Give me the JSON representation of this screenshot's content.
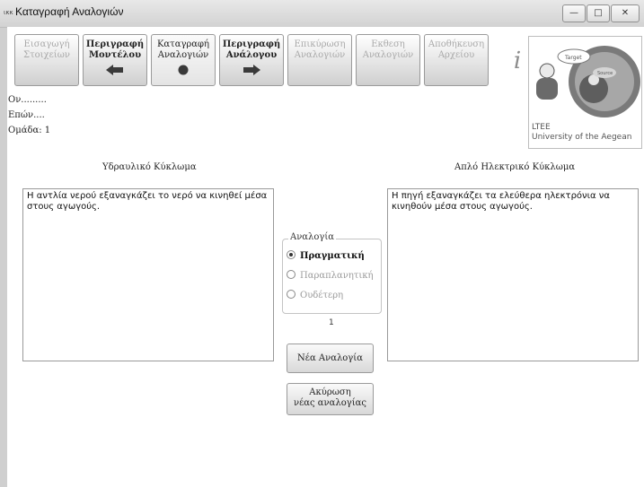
{
  "window": {
    "app_icon": "ικκ",
    "title": "Καταγραφή Αναλογιών",
    "controls": {
      "minimize": "—",
      "maximize": "□",
      "close": "✕"
    }
  },
  "tabs": [
    {
      "line1": "Εισαγωγή",
      "line2": "Στοιχείων",
      "state": "disabled",
      "icon": ""
    },
    {
      "line1": "Περιγραφή",
      "line2": "Μοντέλου",
      "state": "enabled",
      "icon": "arrow-left-icon"
    },
    {
      "line1": "Καταγραφή",
      "line2": "Αναλογιών",
      "state": "active",
      "icon": "dot-icon"
    },
    {
      "line1": "Περιγραφή",
      "line2": "Ανάλογου",
      "state": "enabled",
      "icon": "arrow-right-icon"
    },
    {
      "line1": "Επικύρωση",
      "line2": "Αναλογιών",
      "state": "disabled",
      "icon": ""
    },
    {
      "line1": "Εκθεση",
      "line2": "Αναλογιών",
      "state": "disabled",
      "icon": ""
    },
    {
      "line1": "Αποθήκευση",
      "line2": "Αρχείου",
      "state": "disabled",
      "icon": ""
    }
  ],
  "info_icon": "i",
  "logo": {
    "bubble1": "Target",
    "bubble2": "Source",
    "line1": "LTEE",
    "line2": "University of the Aegean"
  },
  "student": {
    "name": "Ον.........",
    "surname": "Επών....",
    "group": "Ομάδα: 1"
  },
  "left_panel": {
    "title": "Υδραυλικό Κύκλωμα",
    "text": "Η αντλία νερού εξαναγκάζει το νερό να κινηθεί μέσα στους αγωγούς."
  },
  "right_panel": {
    "title": "Απλό Ηλεκτρικό Κύκλωμα",
    "text": "Η πηγή εξαναγκάζει τα ελεύθερα ηλεκτρόνια να κινηθούν μέσα στους αγωγούς."
  },
  "analogy_group": {
    "legend": "Αναλογία",
    "options": [
      "Πραγματική",
      "Παραπλανητική",
      "Ουδέτερη"
    ],
    "selected": "Πραγματική"
  },
  "counter": "1",
  "buttons": {
    "new_analogy": "Νέα Αναλογία",
    "cancel_line1": "Ακύρωση",
    "cancel_line2": "νέας αναλογίας"
  }
}
